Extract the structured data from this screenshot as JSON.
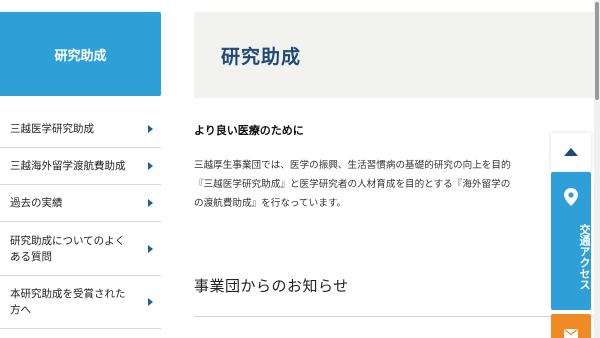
{
  "sidebar": {
    "title": "研究助成",
    "items": [
      {
        "label": "三越医学研究助成"
      },
      {
        "label": "三越海外留学渡航費助成"
      },
      {
        "label": "過去の実績"
      },
      {
        "label": "研究助成についてのよくある質問"
      },
      {
        "label": "本研究助成を受賞された方へ"
      }
    ]
  },
  "main": {
    "title": "研究助成",
    "subheading": "より良い医療のために",
    "intro_lines": [
      "三越厚生事業団では、医学の振興、生活習慣病の基礎的研究の向上を目的",
      "『三越医学研究助成』と医学研究者の人材育成を目的とする『海外留学の",
      "の渡航費助成』を行なっています。"
    ],
    "news_heading": "事業団からのお知らせ"
  },
  "floating": {
    "access_label": "交通アクセス"
  },
  "colors": {
    "accent_blue": "#2f9fd8",
    "title_navy": "#1f4a78",
    "mail_orange": "#f08a24"
  }
}
